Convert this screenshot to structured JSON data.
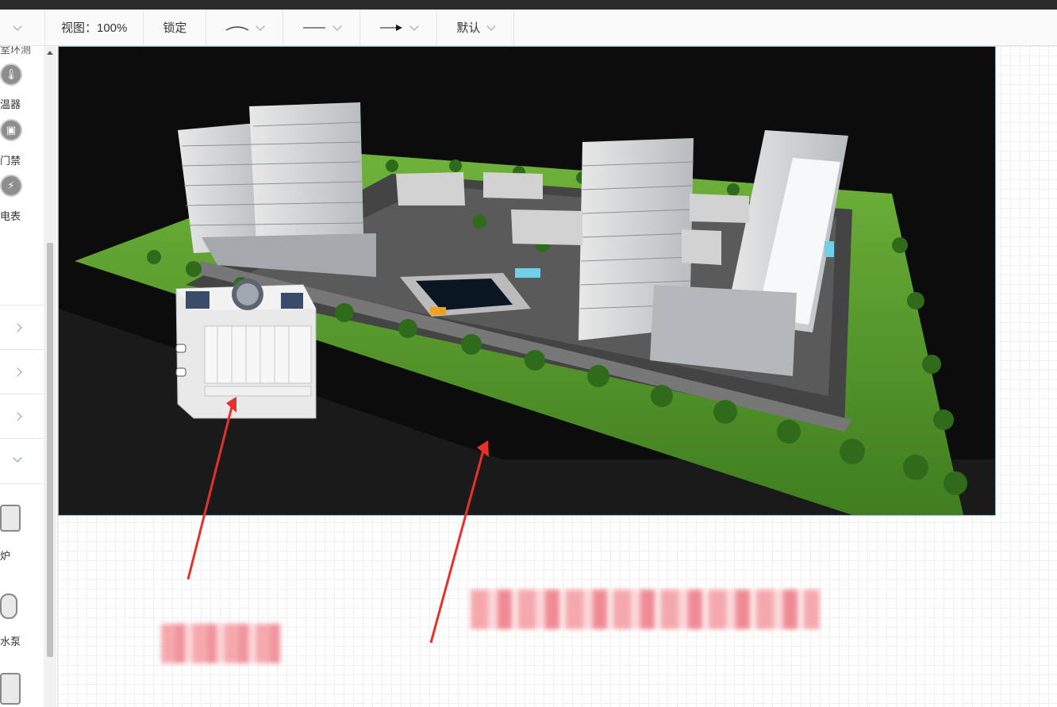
{
  "toolbar": {
    "first_chevron": "",
    "view_label": "视图：100%",
    "lock_label": "锁定",
    "default_label": "默认"
  },
  "sidebar": {
    "items": [
      {
        "label": "温器",
        "icon": "thermometer-icon",
        "glyph": "🌡"
      },
      {
        "label": "门禁",
        "icon": "door-access-icon",
        "glyph": "▣"
      },
      {
        "label": "电表",
        "icon": "electric-meter-icon",
        "glyph": "⚡"
      }
    ],
    "devices": [
      {
        "label": "炉",
        "icon": "boiler-icon"
      },
      {
        "label": "水泵",
        "icon": "water-pump-icon"
      }
    ]
  },
  "colors": {
    "accent": "#5b9bd5",
    "arrow": "#e8302a",
    "scene_bg": "#0c0c0c",
    "lawn": "#5e9e2e"
  }
}
